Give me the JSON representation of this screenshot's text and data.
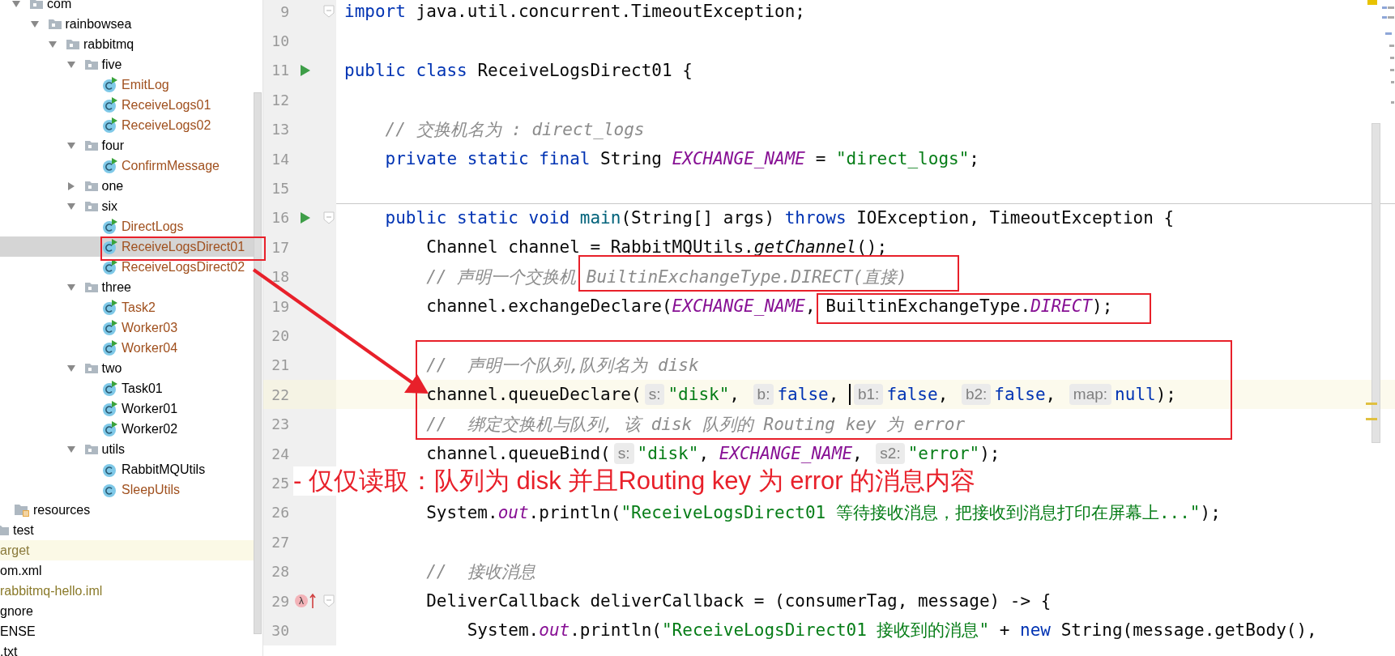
{
  "tree": {
    "items": [
      {
        "label": "com",
        "kind": "package",
        "expanded": true,
        "selected": false,
        "children": [
          {
            "label": "rainbowsea",
            "kind": "package",
            "expanded": true,
            "selected": false,
            "children": [
              {
                "label": "rabbitmq",
                "kind": "package",
                "expanded": true,
                "selected": false,
                "children": [
                  {
                    "label": "five",
                    "kind": "package",
                    "expanded": true,
                    "selected": false,
                    "children": [
                      {
                        "label": "EmitLog",
                        "kind": "class",
                        "runnable": true,
                        "color": "#a0501e",
                        "selected": false
                      },
                      {
                        "label": "ReceiveLogs01",
                        "kind": "class",
                        "runnable": true,
                        "color": "#a0501e",
                        "selected": false
                      },
                      {
                        "label": "ReceiveLogs02",
                        "kind": "class",
                        "runnable": true,
                        "color": "#a0501e",
                        "selected": false
                      }
                    ]
                  },
                  {
                    "label": "four",
                    "kind": "package",
                    "expanded": true,
                    "selected": false,
                    "children": [
                      {
                        "label": "ConfirmMessage",
                        "kind": "class",
                        "runnable": true,
                        "color": "#a0501e",
                        "selected": false
                      }
                    ]
                  },
                  {
                    "label": "one",
                    "kind": "package",
                    "expanded": false,
                    "selected": false
                  },
                  {
                    "label": "six",
                    "kind": "package",
                    "expanded": true,
                    "selected": false,
                    "children": [
                      {
                        "label": "DirectLogs",
                        "kind": "class",
                        "runnable": true,
                        "color": "#a0501e",
                        "selected": false
                      },
                      {
                        "label": "ReceiveLogsDirect01",
                        "kind": "class",
                        "runnable": true,
                        "color": "#a0501e",
                        "selected": true
                      },
                      {
                        "label": "ReceiveLogsDirect02",
                        "kind": "class",
                        "runnable": true,
                        "color": "#a0501e",
                        "selected": false
                      }
                    ]
                  },
                  {
                    "label": "three",
                    "kind": "package",
                    "expanded": true,
                    "selected": false,
                    "children": [
                      {
                        "label": "Task2",
                        "kind": "class",
                        "runnable": true,
                        "color": "#a0501e",
                        "selected": false
                      },
                      {
                        "label": "Worker03",
                        "kind": "class",
                        "runnable": true,
                        "color": "#a0501e",
                        "selected": false
                      },
                      {
                        "label": "Worker04",
                        "kind": "class",
                        "runnable": true,
                        "color": "#a0501e",
                        "selected": false
                      }
                    ]
                  },
                  {
                    "label": "two",
                    "kind": "package",
                    "expanded": true,
                    "selected": false,
                    "children": [
                      {
                        "label": "Task01",
                        "kind": "class",
                        "runnable": true,
                        "color": "#000000",
                        "selected": false
                      },
                      {
                        "label": "Worker01",
                        "kind": "class",
                        "runnable": true,
                        "color": "#000000",
                        "selected": false
                      },
                      {
                        "label": "Worker02",
                        "kind": "class",
                        "runnable": true,
                        "color": "#000000",
                        "selected": false
                      }
                    ]
                  },
                  {
                    "label": "utils",
                    "kind": "package",
                    "expanded": true,
                    "selected": false,
                    "children": [
                      {
                        "label": "RabbitMQUtils",
                        "kind": "class",
                        "runnable": false,
                        "color": "#000000",
                        "selected": false
                      },
                      {
                        "label": "SleepUtils",
                        "kind": "class",
                        "runnable": false,
                        "color": "#a0501e",
                        "selected": false
                      }
                    ]
                  }
                ]
              }
            ]
          }
        ]
      }
    ],
    "outer": [
      {
        "label": "resources",
        "kind": "resources-folder",
        "selected": false,
        "highlighted": false,
        "color": "#000000"
      },
      {
        "label": "test",
        "kind": "folder",
        "selected": false,
        "highlighted": false,
        "color": "#000000"
      },
      {
        "label": "arget",
        "kind": "file",
        "selected": false,
        "highlighted": true,
        "color": "#8a7a3a"
      },
      {
        "label": "om.xml",
        "kind": "file",
        "selected": false,
        "highlighted": false,
        "color": "#000000"
      },
      {
        "label": "rabbitmq-hello.iml",
        "kind": "file",
        "selected": false,
        "highlighted": false,
        "color": "#8a7a2a"
      },
      {
        "label": "gnore",
        "kind": "file",
        "selected": false,
        "highlighted": false,
        "color": "#000000"
      },
      {
        "label": "ENSE",
        "kind": "file",
        "selected": false,
        "highlighted": false,
        "color": "#000000"
      },
      {
        "label": ".txt",
        "kind": "file",
        "selected": false,
        "highlighted": false,
        "color": "#000000"
      }
    ]
  },
  "editor": {
    "lines": [
      {
        "number": "9",
        "fold": true,
        "current": false,
        "tokens": [
          {
            "kind": "kw",
            "text": "import"
          },
          {
            "kind": "plain",
            "text": " java.util.concurrent.TimeoutException;"
          }
        ]
      },
      {
        "number": "10",
        "current": false
      },
      {
        "number": "11",
        "run": true,
        "current": false,
        "tokens": [
          {
            "kind": "kw",
            "text": "public class"
          },
          {
            "kind": "plain",
            "text": " ReceiveLogsDirect01 {"
          }
        ]
      },
      {
        "number": "12",
        "current": false
      },
      {
        "number": "13",
        "current": false,
        "tokens": [
          {
            "kind": "comment",
            "text": "    // 交换机名为 : direct_logs"
          }
        ]
      },
      {
        "number": "14",
        "current": false,
        "tokens": [
          {
            "kind": "kw",
            "text": "    private static final"
          },
          {
            "kind": "plain",
            "text": " String "
          },
          {
            "kind": "const",
            "text": "EXCHANGE_NAME"
          },
          {
            "kind": "plain",
            "text": " = "
          },
          {
            "kind": "str",
            "text": "\"direct_logs\""
          },
          {
            "kind": "plain",
            "text": ";"
          }
        ]
      },
      {
        "number": "15",
        "current": false
      },
      {
        "number": "16",
        "run": true,
        "fold": true,
        "method_start": true,
        "current": false,
        "tokens": [
          {
            "kind": "kw",
            "text": "    public static void "
          },
          {
            "kind": "fn",
            "text": "main"
          },
          {
            "kind": "plain",
            "text": "(String[] args) "
          },
          {
            "kind": "kw",
            "text": "throws"
          },
          {
            "kind": "plain",
            "text": " IOException, TimeoutException {"
          }
        ]
      },
      {
        "number": "17",
        "current": false,
        "tokens": [
          {
            "kind": "plain",
            "text": "        Channel channel = RabbitMQUtils."
          },
          {
            "kind": "italic",
            "text": "getChannel"
          },
          {
            "kind": "plain",
            "text": "();"
          }
        ]
      },
      {
        "number": "18",
        "current": false,
        "tokens": [
          {
            "kind": "comment",
            "text": "        // 声明一个交换机 "
          },
          {
            "kind": "comment",
            "text": "BuiltinExchangeType.DIRECT(直接)"
          }
        ]
      },
      {
        "number": "19",
        "current": false,
        "tokens": [
          {
            "kind": "plain",
            "text": "        channel.exchangeDeclare("
          },
          {
            "kind": "const",
            "text": "EXCHANGE_NAME"
          },
          {
            "kind": "plain",
            "text": ", BuiltinExchangeType."
          },
          {
            "kind": "const",
            "text": "DIRECT"
          },
          {
            "kind": "plain",
            "text": ");"
          }
        ]
      },
      {
        "number": "20",
        "current": false
      },
      {
        "number": "21",
        "current": false,
        "tokens": [
          {
            "kind": "comment",
            "text": "        //  声明一个队列,队列名为 disk"
          }
        ]
      },
      {
        "number": "22",
        "current": true,
        "tokens": [
          {
            "kind": "plain",
            "text": "        channel.queueDeclare("
          },
          {
            "kind": "hint",
            "text": "s:"
          },
          {
            "kind": "str",
            "text": "\"disk\""
          },
          {
            "kind": "plain",
            "text": ", "
          },
          {
            "kind": "hint",
            "text": "b:"
          },
          {
            "kind": "kw",
            "text": "false"
          },
          {
            "kind": "plain",
            "text": ", "
          },
          {
            "kind": "caret"
          },
          {
            "kind": "hint",
            "text": "b1:"
          },
          {
            "kind": "kw",
            "text": "false"
          },
          {
            "kind": "plain",
            "text": ", "
          },
          {
            "kind": "hint",
            "text": "b2:"
          },
          {
            "kind": "kw",
            "text": "false"
          },
          {
            "kind": "plain",
            "text": ", "
          },
          {
            "kind": "hint",
            "text": "map:"
          },
          {
            "kind": "kw",
            "text": "null"
          },
          {
            "kind": "plain",
            "text": ");"
          }
        ]
      },
      {
        "number": "23",
        "current": false,
        "tokens": [
          {
            "kind": "comment",
            "text": "        //  绑定交换机与队列, 该 disk 队列的 Routing key 为 error"
          }
        ]
      },
      {
        "number": "24",
        "current": false,
        "tokens": [
          {
            "kind": "plain",
            "text": "        channel.queueBind("
          },
          {
            "kind": "hint",
            "text": "s:"
          },
          {
            "kind": "str",
            "text": "\"disk\""
          },
          {
            "kind": "plain",
            "text": ", "
          },
          {
            "kind": "const",
            "text": "EXCHANGE_NAME"
          },
          {
            "kind": "plain",
            "text": ", "
          },
          {
            "kind": "hint",
            "text": "s2:"
          },
          {
            "kind": "str",
            "text": "\"error\""
          },
          {
            "kind": "plain",
            "text": ");"
          }
        ]
      },
      {
        "number": "25",
        "current": false
      },
      {
        "number": "26",
        "current": false,
        "tokens": [
          {
            "kind": "plain",
            "text": "        System."
          },
          {
            "kind": "const",
            "text": "out"
          },
          {
            "kind": "plain",
            "text": ".println("
          },
          {
            "kind": "str",
            "text": "\"ReceiveLogsDirect01 等待接收消息，把接收到消息打印在屏幕上...\""
          },
          {
            "kind": "plain",
            "text": ");"
          }
        ]
      },
      {
        "number": "27",
        "current": false
      },
      {
        "number": "28",
        "current": false,
        "tokens": [
          {
            "kind": "comment",
            "text": "        //  接收消息"
          }
        ]
      },
      {
        "number": "29",
        "fold": true,
        "marker": "λ",
        "current": false,
        "tokens": [
          {
            "kind": "plain",
            "text": "        DeliverCallback deliverCallback = (consumerTag, message) -> {"
          }
        ]
      },
      {
        "number": "30",
        "current": false,
        "tokens": [
          {
            "kind": "plain",
            "text": "            System."
          },
          {
            "kind": "const",
            "text": "out"
          },
          {
            "kind": "plain",
            "text": ".println("
          },
          {
            "kind": "str",
            "text": "\"ReceiveLogsDirect01 接收到的消息\""
          },
          {
            "kind": "plain",
            "text": " + "
          },
          {
            "kind": "kw",
            "text": "new"
          },
          {
            "kind": "plain",
            "text": " String(message.getBody(),"
          }
        ]
      }
    ]
  },
  "annotations": {
    "note": "- 仅仅读取：队列为 disk  并且Routing key 为 error 的消息内容"
  }
}
